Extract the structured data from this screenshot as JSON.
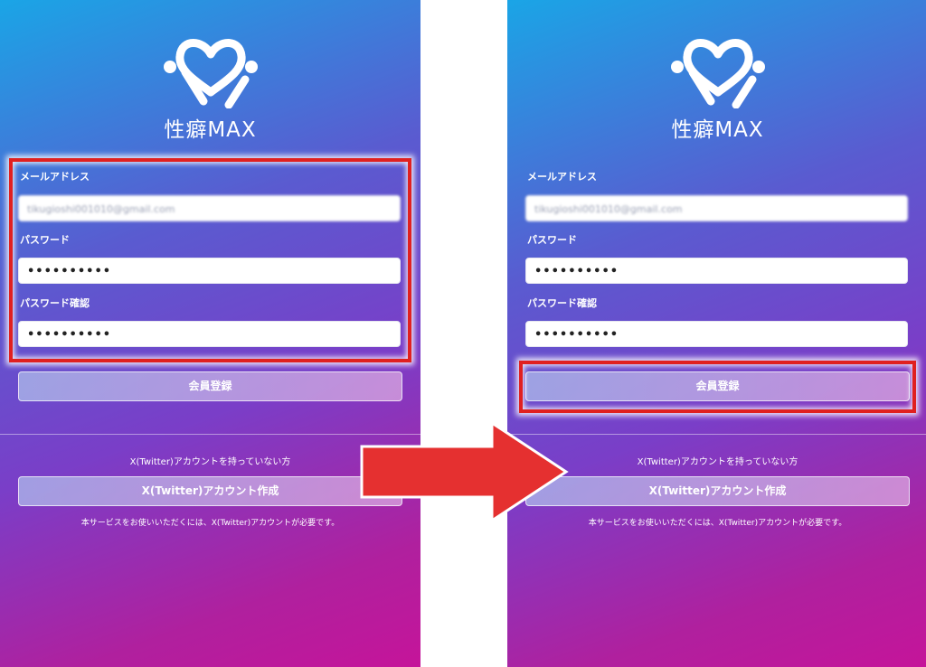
{
  "app": {
    "logo_text": "性癖MAX"
  },
  "form": {
    "email_label": "メールアドレス",
    "email_value": "tikugioshi001010@gmail.com",
    "password_label": "パスワード",
    "password_value": "••••••••••",
    "password_confirm_label": "パスワード確認",
    "password_confirm_value": "••••••••••",
    "register_button": "会員登録"
  },
  "twitter": {
    "prompt": "X(Twitter)アカウントを持っていない方",
    "create_button": "X(Twitter)アカウント作成",
    "note": "本サービスをお使いいただくには、X(Twitter)アカウントが必要です。"
  },
  "colors": {
    "gradient_start": "#1aa5e6",
    "gradient_end": "#c5149a",
    "highlight": "#e02020",
    "arrow": "#e53030"
  },
  "icons": {
    "logo": "heart-check-logo-icon",
    "arrow": "right-arrow-icon"
  }
}
